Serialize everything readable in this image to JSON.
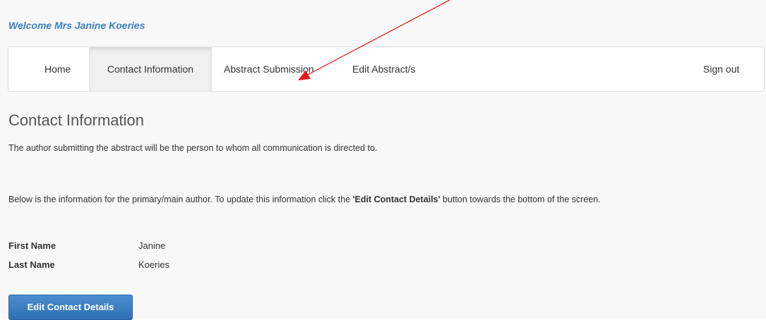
{
  "header": {
    "welcome": "Welcome Mrs Janine Koeries"
  },
  "nav": {
    "home": "Home",
    "contact_information": "Contact Information",
    "abstract_submission": "Abstract Submission",
    "edit_abstracts": "Edit Abstract/s",
    "sign_out": "Sign out",
    "active": "Contact Information"
  },
  "main": {
    "title": "Contact Information",
    "intro": "The author submitting the abstract will be the person to whom all communication is directed to.",
    "info_before": "Below is the information for the primary/main author. To update this information click the ",
    "info_bold": "'Edit Contact Details'",
    "info_after": " button towards the bottom of the screen.",
    "fields": [
      {
        "label": "First Name",
        "value": "Janine"
      },
      {
        "label": "Last Name",
        "value": "Koeries"
      }
    ],
    "edit_button": "Edit Contact Details"
  },
  "annotation": {
    "arrow_color": "#e8161e",
    "arrow_target": "Abstract Submission"
  },
  "colors": {
    "accent": "#3a7fc1",
    "button": "#337ab7",
    "background": "#f8f8f8"
  }
}
